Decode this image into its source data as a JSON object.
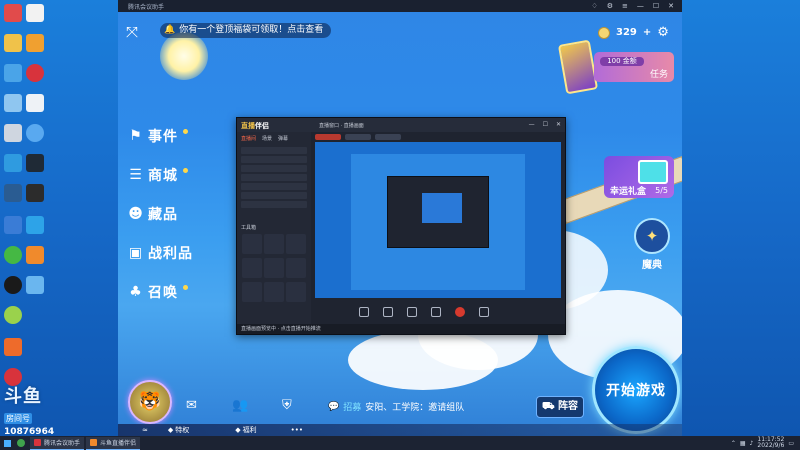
{
  "app": {
    "window_title": "腾讯会议助手",
    "notice_text": "你有一个登顶福袋可领取！点击查看",
    "coins": "329",
    "task_progress": "100 金额",
    "task_label": "任务",
    "nav": [
      {
        "label": "事件"
      },
      {
        "label": "商城"
      },
      {
        "label": "藏品"
      },
      {
        "label": "战利品"
      },
      {
        "label": "召唤"
      }
    ],
    "gift_label": "幸运礼盒",
    "gift_count": "5/5",
    "codex_label": "魔典",
    "recruit_tag": "招募",
    "recruit_text": "安阳、工学院：邀请组队",
    "lineup_label": "阵容",
    "start_label": "开始游戏",
    "bottom_items": [
      "特权",
      "福利"
    ]
  },
  "stream": {
    "logo_a": "直播",
    "logo_b": "伴侣",
    "tab": "直播窗口 · 直播画面",
    "left_tabs": [
      "直播间",
      "场景",
      "弹幕"
    ],
    "tools_label": "工具箱",
    "status": "直播画面预览中 · 点击直播开始推流"
  },
  "watermark": {
    "logo": "斗鱼",
    "sub": "房间号",
    "room": "10876964"
  },
  "taskbar": {
    "items": [
      "腾讯会议助手",
      "斗鱼直播伴侣"
    ],
    "time": "11:17:52",
    "date": "2022/9/6"
  },
  "colors": {
    "sky": "#2e8ae9",
    "accent": "#ffd84a",
    "record": "#d63a2e"
  }
}
